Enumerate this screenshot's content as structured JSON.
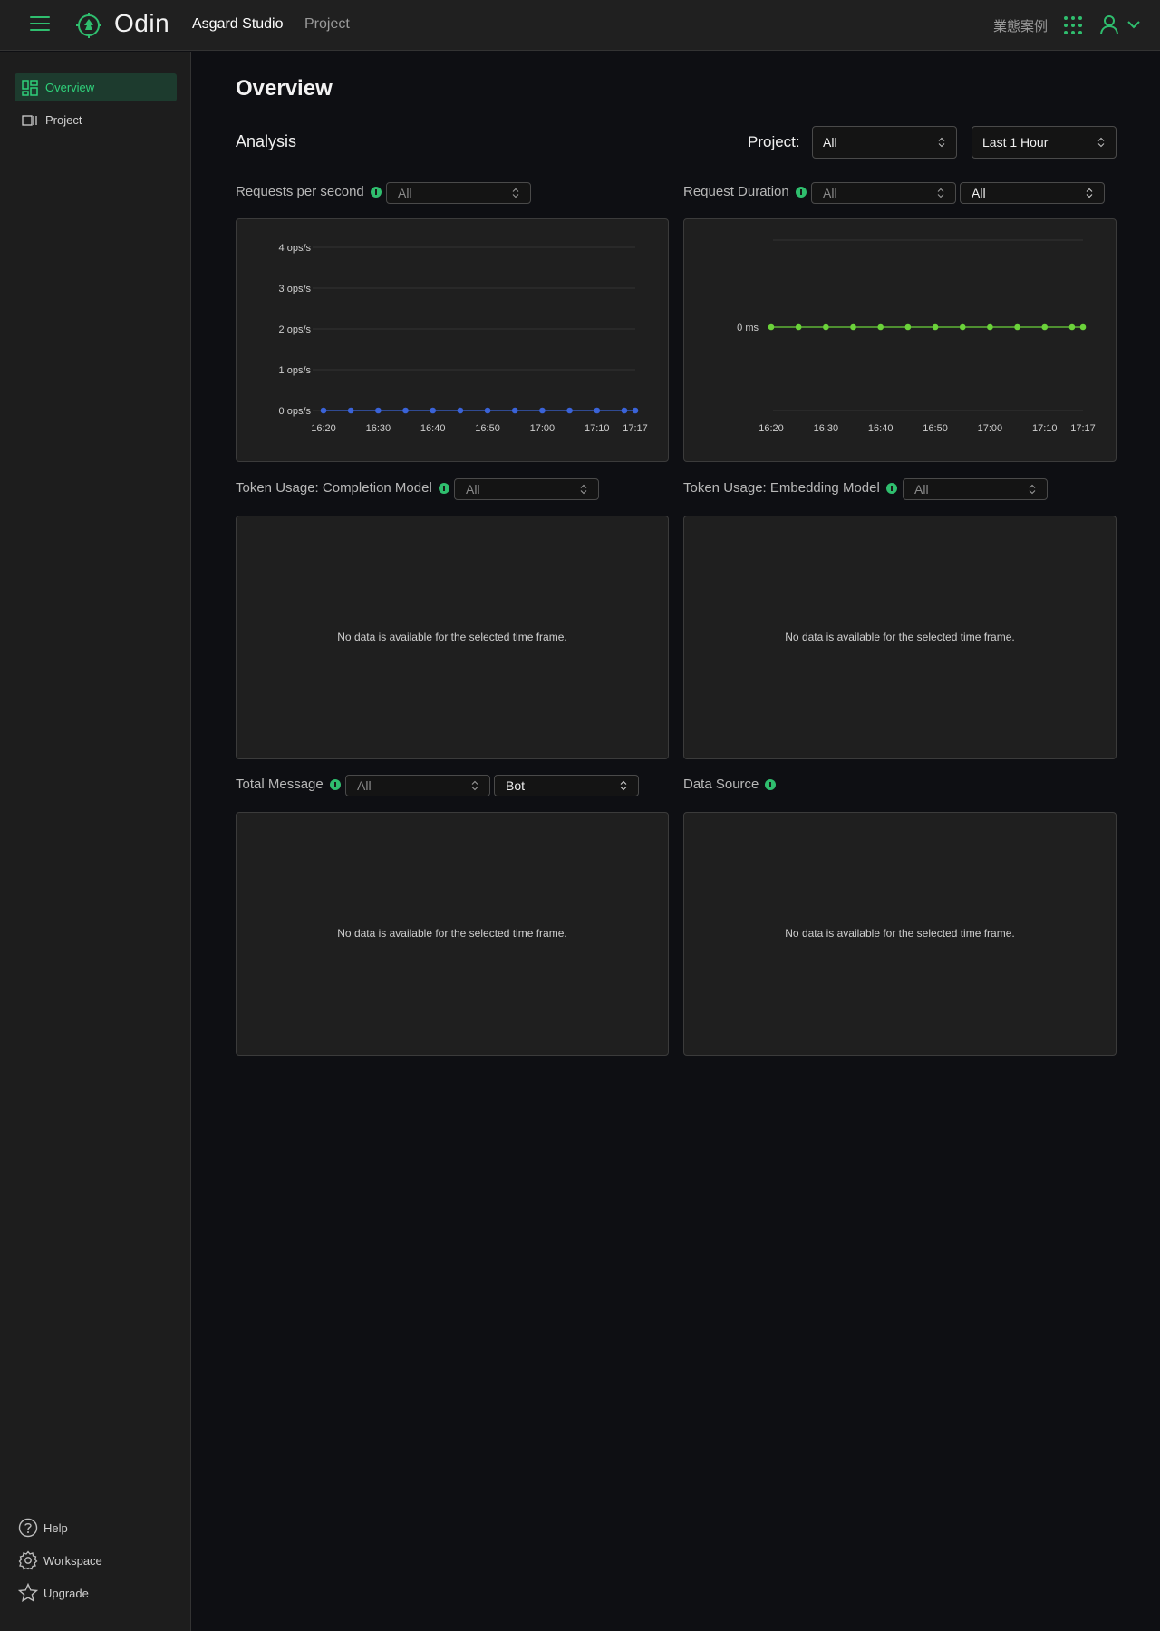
{
  "topbar": {
    "logo_text": "Odin",
    "nav_studio": "Asgard Studio",
    "nav_project": "Project",
    "cases_label": "業態案例",
    "accent_color": "#2fbe6e",
    "icons": [
      "menu-icon",
      "logo-icon",
      "apps-grid-icon",
      "user-icon",
      "chevron-down-icon"
    ]
  },
  "sidebar": {
    "items": [
      {
        "label": "Overview",
        "icon": "dashboard-icon",
        "active": true
      },
      {
        "label": "Project",
        "icon": "project-icon",
        "active": false
      }
    ],
    "bottom": [
      {
        "label": "Help",
        "icon": "help-icon"
      },
      {
        "label": "Workspace",
        "icon": "gear-icon"
      },
      {
        "label": "Upgrade",
        "icon": "star-icon"
      }
    ]
  },
  "main": {
    "title": "Overview",
    "analysis_title": "Analysis",
    "project_label": "Project:",
    "project_select": "All",
    "time_select": "Last 1 Hour"
  },
  "sections": {
    "rps": {
      "title": "Requests per second",
      "select": "All"
    },
    "duration": {
      "title": "Request Duration",
      "select1": "All",
      "select2": "All"
    },
    "completion": {
      "title": "Token Usage: Completion Model",
      "select": "All",
      "empty": "No data is available for the selected time frame."
    },
    "embedding": {
      "title": "Token Usage: Embedding Model",
      "select": "All",
      "empty": "No data is available for the selected time frame."
    },
    "total_message": {
      "title": "Total Message",
      "select1": "All",
      "select2": "Bot",
      "empty": "No data is available for the selected time frame."
    },
    "data_source": {
      "title": "Data Source",
      "empty": "No data is available for the selected time frame."
    }
  },
  "chart_data": [
    {
      "type": "line",
      "name": "rps",
      "x": [
        "16:20",
        "16:25",
        "16:30",
        "16:35",
        "16:40",
        "16:45",
        "16:50",
        "16:55",
        "17:00",
        "17:05",
        "17:10",
        "17:15",
        "17:17"
      ],
      "x_tick_labels": [
        "16:20",
        "16:30",
        "16:40",
        "16:50",
        "17:00",
        "17:10",
        "17:17"
      ],
      "series": [
        {
          "values": [
            0,
            0,
            0,
            0,
            0,
            0,
            0,
            0,
            0,
            0,
            0,
            0,
            0
          ],
          "color": "#3a63d8"
        }
      ],
      "y_tick_labels": [
        "4 ops/s",
        "3 ops/s",
        "2 ops/s",
        "1 ops/s",
        "0 ops/s"
      ],
      "ylim": [
        0,
        4
      ],
      "grid": true
    },
    {
      "type": "line",
      "name": "duration",
      "x": [
        "16:20",
        "16:25",
        "16:30",
        "16:35",
        "16:40",
        "16:45",
        "16:50",
        "16:55",
        "17:00",
        "17:05",
        "17:10",
        "17:15",
        "17:17"
      ],
      "x_tick_labels": [
        "16:20",
        "16:30",
        "16:40",
        "16:50",
        "17:00",
        "17:10",
        "17:17"
      ],
      "series": [
        {
          "values": [
            0,
            0,
            0,
            0,
            0,
            0,
            0,
            0,
            0,
            0,
            0,
            0,
            0
          ],
          "color": "#6bd23a"
        }
      ],
      "y_tick_labels": [
        "0 ms"
      ],
      "grid": true
    }
  ]
}
